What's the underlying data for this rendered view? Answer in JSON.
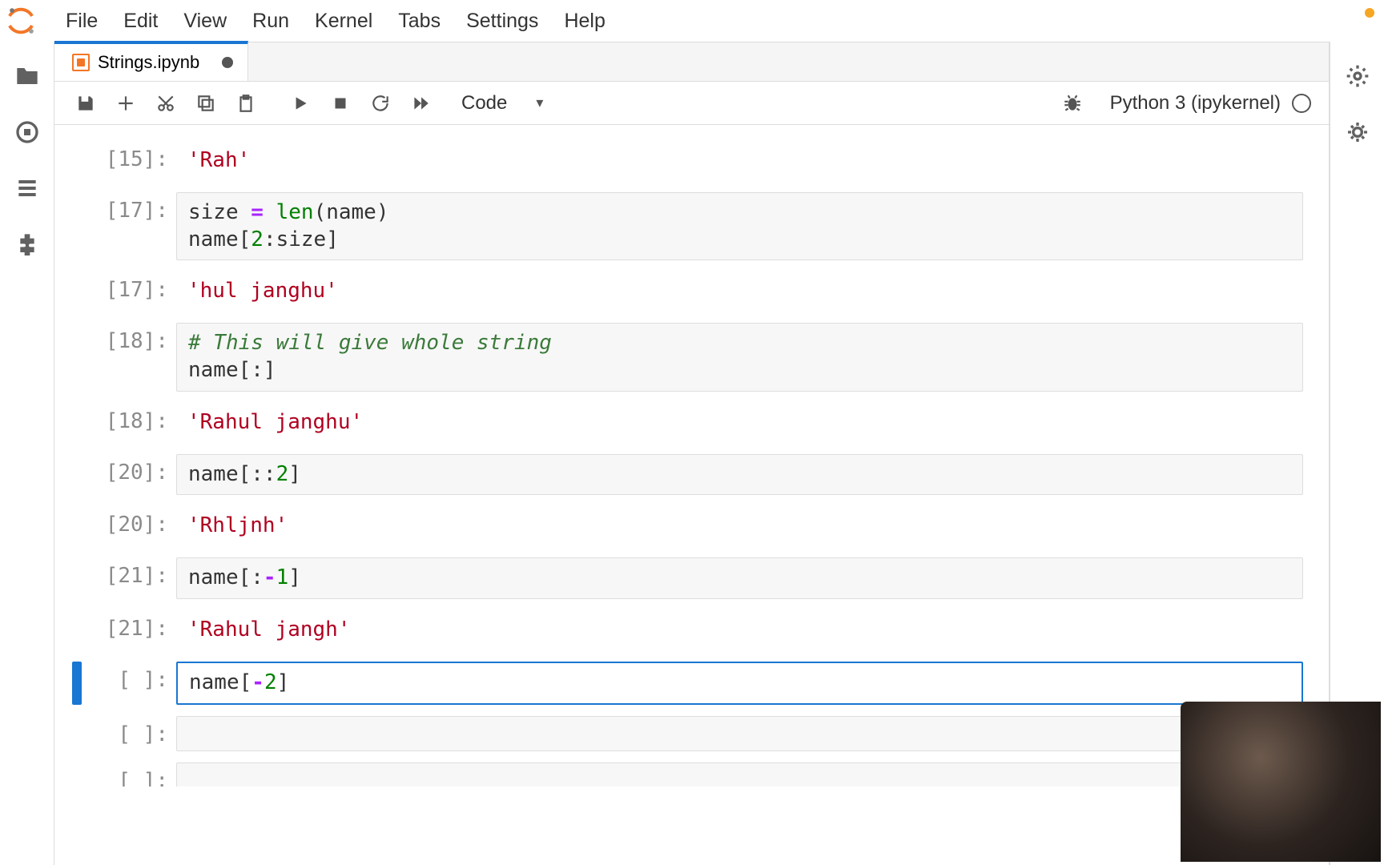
{
  "menu": {
    "items": [
      "File",
      "Edit",
      "View",
      "Run",
      "Kernel",
      "Tabs",
      "Settings",
      "Help"
    ]
  },
  "tab": {
    "title": "Strings.ipynb"
  },
  "toolbar": {
    "celltype": "Code"
  },
  "kernel": {
    "name": "Python 3 (ipykernel)"
  },
  "cells": [
    {
      "ptype": "out",
      "n": "15",
      "tokens": [
        {
          "t": "str",
          "v": "'Rah'"
        }
      ]
    },
    {
      "ptype": "in",
      "n": "17",
      "lines": [
        [
          {
            "t": "",
            "v": "size "
          },
          {
            "t": "op",
            "v": "="
          },
          {
            "t": "",
            "v": " "
          },
          {
            "t": "builtin",
            "v": "len"
          },
          {
            "t": "",
            "v": "(name)"
          }
        ],
        [
          {
            "t": "",
            "v": "name["
          },
          {
            "t": "num",
            "v": "2"
          },
          {
            "t": "",
            "v": ":size]"
          }
        ]
      ]
    },
    {
      "ptype": "out",
      "n": "17",
      "tokens": [
        {
          "t": "str",
          "v": "'hul janghu'"
        }
      ]
    },
    {
      "ptype": "in",
      "n": "18",
      "lines": [
        [
          {
            "t": "cm",
            "v": "# This will give whole string"
          }
        ],
        [
          {
            "t": "",
            "v": "name[:]"
          }
        ]
      ]
    },
    {
      "ptype": "out",
      "n": "18",
      "tokens": [
        {
          "t": "str",
          "v": "'Rahul janghu'"
        }
      ]
    },
    {
      "ptype": "in",
      "n": "20",
      "lines": [
        [
          {
            "t": "",
            "v": "name[::"
          },
          {
            "t": "num",
            "v": "2"
          },
          {
            "t": "",
            "v": "]"
          }
        ]
      ]
    },
    {
      "ptype": "out",
      "n": "20",
      "tokens": [
        {
          "t": "str",
          "v": "'Rhljnh'"
        }
      ]
    },
    {
      "ptype": "in",
      "n": "21",
      "lines": [
        [
          {
            "t": "",
            "v": "name[:"
          },
          {
            "t": "op",
            "v": "-"
          },
          {
            "t": "num",
            "v": "1"
          },
          {
            "t": "",
            "v": "]"
          }
        ]
      ]
    },
    {
      "ptype": "out",
      "n": "21",
      "tokens": [
        {
          "t": "str",
          "v": "'Rahul jangh'"
        }
      ]
    },
    {
      "ptype": "in",
      "n": " ",
      "active": true,
      "lines": [
        [
          {
            "t": "",
            "v": "name["
          },
          {
            "t": "op",
            "v": "-"
          },
          {
            "t": "num",
            "v": "2"
          },
          {
            "t": "",
            "v": "]"
          }
        ]
      ]
    },
    {
      "ptype": "in",
      "n": " ",
      "lines": [
        [
          {
            "t": "",
            "v": ""
          }
        ]
      ]
    },
    {
      "ptype": "in",
      "n": " ",
      "cutoff": true,
      "lines": [
        [
          {
            "t": "",
            "v": ""
          }
        ]
      ]
    }
  ]
}
